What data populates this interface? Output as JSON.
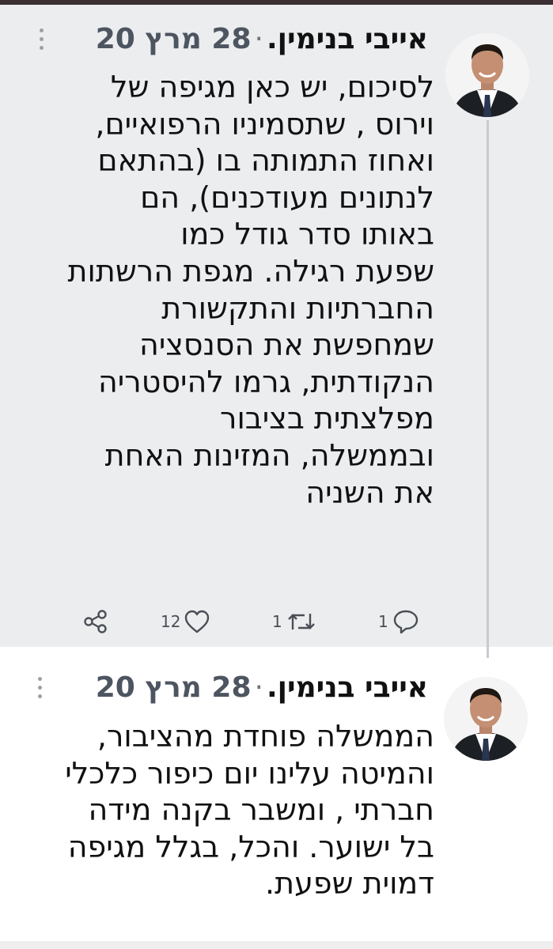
{
  "tweets": [
    {
      "author": "אייבי בנימין.",
      "date": "28 מרץ 20",
      "separator": "·",
      "lines": [
        "לסיכום, יש כאן מגיפה של",
        "וירוס , שתסמיניו הרפואיים,",
        "ואחוז התמותה בו (בהתאם",
        "לנתונים מעודכנים), הם",
        "באותו סדר גודל כמו",
        "שפעת רגילה. מגפת הרשתות",
        "החברתיות והתקשורת",
        "שמחפשת את הסנסציה",
        "הנקודתית, גרמו להיסטריה",
        "מפלצתית בציבור",
        "ובממשלה, המזינות האחת",
        "את השניה"
      ],
      "actions": {
        "likes": "12",
        "retweets": "1",
        "replies": "1"
      },
      "icons": [
        "more-vertical-icon",
        "share-icon",
        "heart-icon",
        "retweet-icon",
        "reply-icon"
      ]
    },
    {
      "author": "אייבי בנימין.",
      "date": "28 מרץ 20",
      "separator": "·",
      "lines": [
        "הממשלה פוחדת מהציבור,",
        "והמיטה עלינו יום כיפור כלכלי",
        "חברתי , ומשבר בקנה מידה",
        "בל ישוער. והכל, בגלל מגיפה",
        "דמוית שפעת."
      ],
      "icons": [
        "more-vertical-icon"
      ]
    }
  ],
  "colors": {
    "thread_background": "#ecedef",
    "text": "#111111",
    "secondary_text": "#4d5560",
    "thread_line": "#c7cbd0",
    "icon": "#4a4f55"
  }
}
